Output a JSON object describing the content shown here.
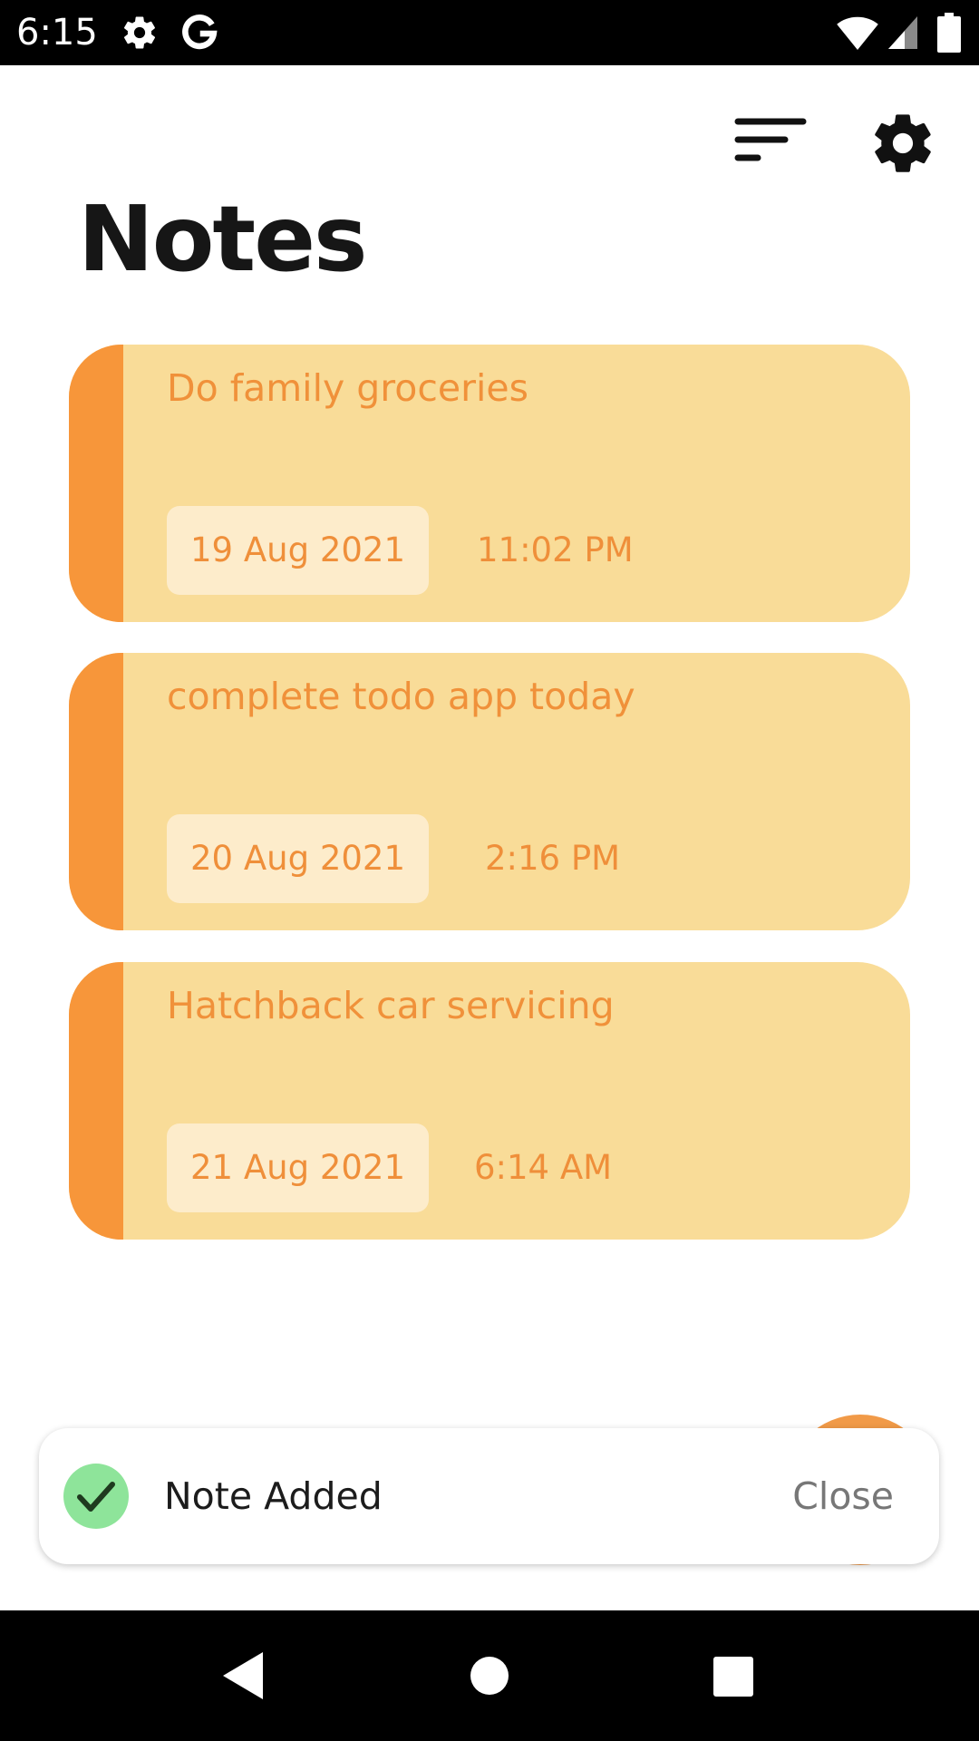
{
  "status_bar": {
    "time": "6:15",
    "icons": [
      "settings-icon",
      "google-g-icon",
      "wifi-icon",
      "cell-signal-icon",
      "battery-icon"
    ]
  },
  "toolbar": {
    "sort_icon": "sort-icon",
    "settings_icon": "gear-icon"
  },
  "page": {
    "title": "Notes"
  },
  "notes": [
    {
      "title": "Do family groceries",
      "date": "19 Aug 2021",
      "time": "11:02 PM"
    },
    {
      "title": "complete todo app today",
      "date": "20 Aug 2021",
      "time": "2:16 PM"
    },
    {
      "title": "Hatchback car servicing",
      "date": "21 Aug 2021",
      "time": "6:14 AM"
    }
  ],
  "toast": {
    "icon": "check-circle-icon",
    "message": "Note Added",
    "close_label": "Close"
  },
  "nav_bar": {
    "icons": [
      "back-icon",
      "home-icon",
      "recents-icon"
    ]
  },
  "colors": {
    "card_background": "#f9dc98",
    "card_accent": "#f7963a",
    "note_text": "#f0913a",
    "date_chip": "#fdeccb",
    "toast_check": "#8ee49a",
    "fab": "#f19a48"
  }
}
